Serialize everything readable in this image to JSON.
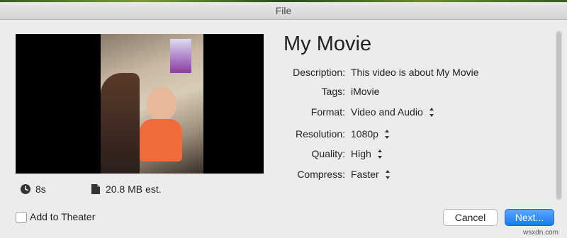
{
  "window": {
    "title": "File"
  },
  "media": {
    "duration": "8s",
    "size_estimate": "20.8 MB est."
  },
  "details": {
    "movie_title": "My Movie",
    "fields": [
      {
        "label": "Description:",
        "value": "This video is about My Movie",
        "stepper": false
      },
      {
        "label": "Tags:",
        "value": "iMovie",
        "stepper": false
      },
      {
        "label": "Format:",
        "value": "Video and Audio",
        "stepper": true
      },
      {
        "label": "Resolution:",
        "value": "1080p",
        "stepper": true
      },
      {
        "label": "Quality:",
        "value": "High",
        "stepper": true
      },
      {
        "label": "Compress:",
        "value": "Faster",
        "stepper": true
      }
    ]
  },
  "footer": {
    "add_to_theater_label": "Add to Theater",
    "add_to_theater_checked": false,
    "cancel_label": "Cancel",
    "next_label": "Next..."
  },
  "watermark": "wsxdn.com",
  "icons": {
    "duration": "clock-icon",
    "size": "document-icon",
    "stepper": "up-down-stepper-icon"
  },
  "colors": {
    "accent": "#1a7af2",
    "dialog_bg": "#ececec"
  }
}
